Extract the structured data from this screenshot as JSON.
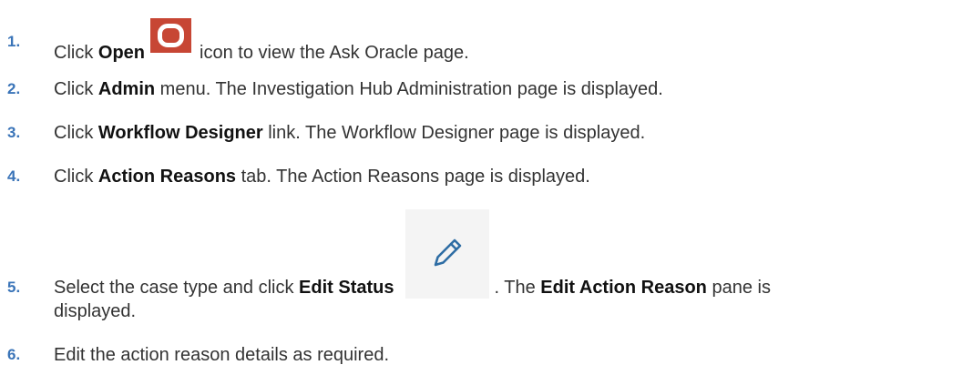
{
  "steps": [
    {
      "num": "1.",
      "pre": "Click ",
      "bold": "Open",
      "post": "icon to view the Ask Oracle page."
    },
    {
      "num": "2.",
      "pre": "Click ",
      "bold": "Admin",
      "post": " menu. The Investigation Hub Administration page is displayed."
    },
    {
      "num": "3.",
      "pre": "Click ",
      "bold": "Workflow Designer",
      "post": " link. The Workflow Designer page is displayed."
    },
    {
      "num": "4.",
      "pre": "Click ",
      "bold": "Action Reasons",
      "post": " tab. The Action Reasons page is displayed."
    },
    {
      "num": "5.",
      "pre": "Select the case type and click ",
      "bold": "Edit Status",
      "post": ". The ",
      "bold2": "Edit Action Reason",
      "post2": " pane is",
      "line2": "displayed."
    },
    {
      "num": "6.",
      "text": "Edit the action reason details as required."
    }
  ],
  "icons": {
    "open": "oracle-open-icon",
    "edit": "pencil-edit-icon",
    "open_color": "#c74634",
    "edit_color": "#2e6da4",
    "number_color": "#3a74b8"
  }
}
